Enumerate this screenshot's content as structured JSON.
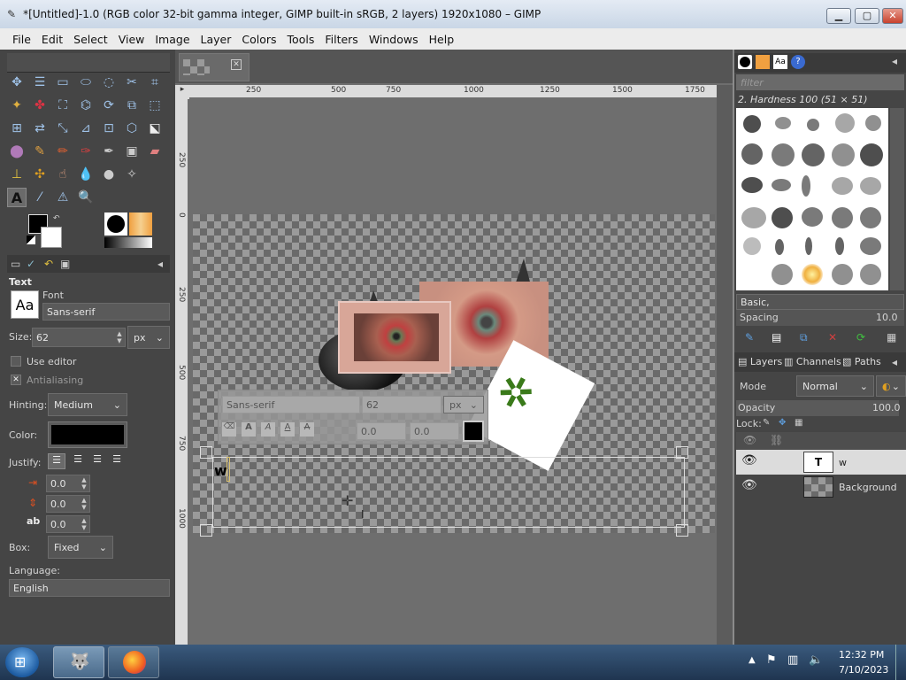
{
  "window": {
    "title": "*[Untitled]-1.0 (RGB color 32-bit gamma integer, GIMP built-in sRGB, 2 layers) 1920x1080 – GIMP"
  },
  "menu": [
    "File",
    "Edit",
    "Select",
    "View",
    "Image",
    "Layer",
    "Colors",
    "Tools",
    "Filters",
    "Windows",
    "Help"
  ],
  "tool_options": {
    "title": "Text",
    "font_label": "Font",
    "font_value": "Sans-serif",
    "font_preview": "Aa",
    "size_label": "Size:",
    "size_value": "62",
    "size_unit": "px",
    "use_editor": "Use editor",
    "antialiasing": "Antialiasing",
    "hinting_label": "Hinting:",
    "hinting_value": "Medium",
    "color_label": "Color:",
    "color_value": "#000000",
    "justify_label": "Justify:",
    "indent": "0.0",
    "line_spacing": "0.0",
    "letter_spacing": "0.0",
    "box_label": "Box:",
    "box_value": "Fixed",
    "language_label": "Language:",
    "language_value": "English"
  },
  "ruler": {
    "h_ticks": [
      "250",
      "500",
      "750",
      "1000",
      "1250",
      "1500",
      "1750"
    ],
    "v_ticks": [
      "250",
      "0",
      "250",
      "500",
      "750",
      "1000"
    ]
  },
  "text_toolbar": {
    "font": "Sans-serif",
    "size": "62",
    "unit": "px",
    "baseline": "0.0",
    "kerning": "0.0"
  },
  "canvas_text": "w",
  "brushes": {
    "filter_placeholder": "filter",
    "current": "2. Hardness 100 (51 × 51)",
    "preset": "Basic,",
    "spacing_label": "Spacing",
    "spacing_value": "10.0"
  },
  "layers_panel": {
    "tabs": [
      "Layers",
      "Channels",
      "Paths"
    ],
    "mode_label": "Mode",
    "mode_value": "Normal",
    "opacity_label": "Opacity",
    "opacity_value": "100.0",
    "lock_label": "Lock:",
    "layers": [
      {
        "name": "w"
      },
      {
        "name": "Background"
      }
    ]
  },
  "taskbar": {
    "time": "12:32 PM",
    "date": "7/10/2023"
  }
}
